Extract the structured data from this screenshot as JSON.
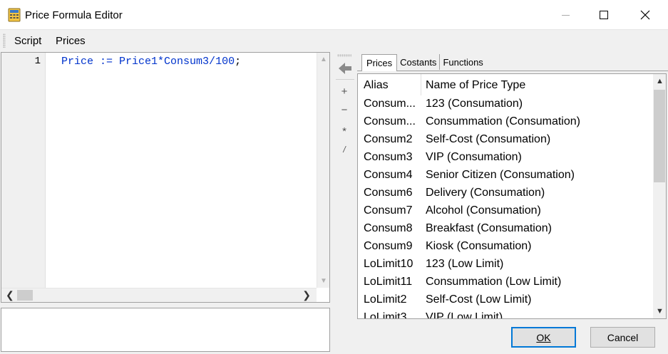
{
  "window": {
    "title": "Price Formula Editor",
    "icon": "calculator-app-icon"
  },
  "menu": {
    "script": "Script",
    "prices": "Prices"
  },
  "editor": {
    "line_number": "1",
    "code": {
      "var": "Price",
      "op": " := ",
      "expr": "Price1*Consum3/",
      "num": "100",
      "end": ";"
    }
  },
  "operators": {
    "insert": "left-arrow-icon",
    "plus": "+",
    "minus": "−",
    "multiply": "*",
    "divide": "/"
  },
  "tabs": [
    "Prices",
    "Costants",
    "Functions"
  ],
  "list": {
    "headers": {
      "alias": "Alias",
      "name": "Name of Price Type"
    },
    "rows": [
      {
        "alias": "Consum...",
        "name": "123 (Consumation)"
      },
      {
        "alias": "Consum...",
        "name": "Consummation (Consumation)"
      },
      {
        "alias": "Consum2",
        "name": "Self-Cost (Consumation)"
      },
      {
        "alias": "Consum3",
        "name": "VIP (Consumation)"
      },
      {
        "alias": "Consum4",
        "name": "Senior Citizen (Consumation)"
      },
      {
        "alias": "Consum6",
        "name": "Delivery (Consumation)"
      },
      {
        "alias": "Consum7",
        "name": "Alcohol (Consumation)"
      },
      {
        "alias": "Consum8",
        "name": "Breakfast (Consumation)"
      },
      {
        "alias": "Consum9",
        "name": "Kiosk (Consumation)"
      },
      {
        "alias": "LoLimit10",
        "name": "123 (Low Limit)"
      },
      {
        "alias": "LoLimit11",
        "name": "Consummation (Low Limit)"
      },
      {
        "alias": "LoLimit2",
        "name": "Self-Cost (Low Limit)"
      },
      {
        "alias": "LoLimit3",
        "name": "VIP (Low Limit)"
      }
    ]
  },
  "buttons": {
    "ok": "OK",
    "cancel": "Cancel"
  },
  "colors": {
    "code_blue": "#0033cc",
    "focus_border": "#0078d7"
  }
}
